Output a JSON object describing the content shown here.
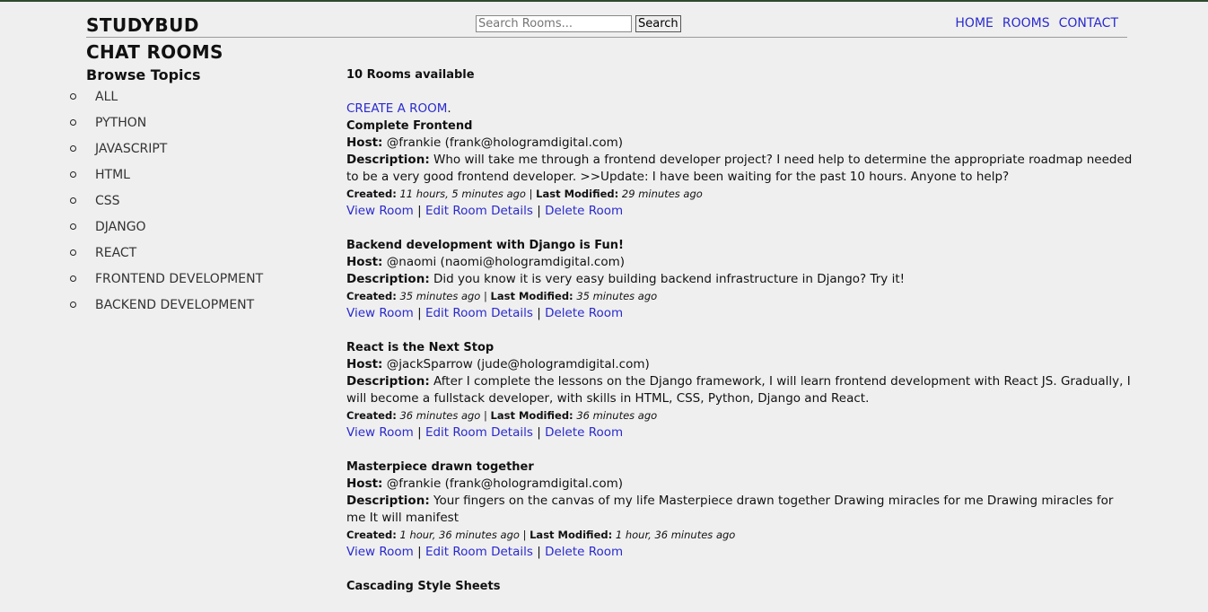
{
  "header": {
    "brand": "STUDYBUD",
    "search_placeholder": "Search Rooms...",
    "search_button": "Search",
    "nav": [
      "HOME",
      "ROOMS",
      "CONTACT"
    ]
  },
  "page_title": "CHAT ROOMS",
  "sidebar": {
    "heading": "Browse Topics",
    "topics": [
      "ALL",
      "PYTHON",
      "JAVASCRIPT",
      "HTML",
      "CSS",
      "DJANGO",
      "REACT",
      "FRONTEND DEVELOPMENT",
      "BACKEND DEVELOPMENT"
    ]
  },
  "main": {
    "count_text": "10 Rooms available",
    "create_link": "CREATE A ROOM",
    "create_suffix": ".",
    "labels": {
      "host": "Host:",
      "description": "Description:",
      "created": "Created:",
      "modified": "Last Modified:",
      "view": "View Room",
      "edit": "Edit Room Details",
      "delete": "Delete Room",
      "sep": "|"
    },
    "rooms": [
      {
        "title": "Complete Frontend",
        "host": "@frankie (frank@hologramdigital.com)",
        "description": "Who will take me through a frontend developer project? I need help to determine the appropriate roadmap needed to be a very good frontend developer. >>Update: I have been waiting for the past 10 hours. Anyone to help?",
        "created": "11 hours, 5 minutes ago",
        "modified": "29 minutes ago"
      },
      {
        "title": "Backend development with Django is Fun!",
        "host": "@naomi (naomi@hologramdigital.com)",
        "description": "Did you know it is very easy building backend infrastructure in Django? Try it!",
        "created": "35 minutes ago",
        "modified": "35 minutes ago"
      },
      {
        "title": "React is the Next Stop",
        "host": "@jackSparrow (jude@hologramdigital.com)",
        "description": "After I complete the lessons on the Django framework, I will learn frontend development with React JS. Gradually, I will become a fullstack developer, with skills in HTML, CSS, Python, Django and React.",
        "created": "36 minutes ago",
        "modified": "36 minutes ago"
      },
      {
        "title": "Masterpiece drawn together",
        "host": "@frankie (frank@hologramdigital.com)",
        "description": "Your fingers on the canvas of my life Masterpiece drawn together Drawing miracles for me Drawing miracles for me It will manifest",
        "created": "1 hour, 36 minutes ago",
        "modified": "1 hour, 36 minutes ago"
      },
      {
        "title": "Cascading Style Sheets"
      }
    ]
  }
}
